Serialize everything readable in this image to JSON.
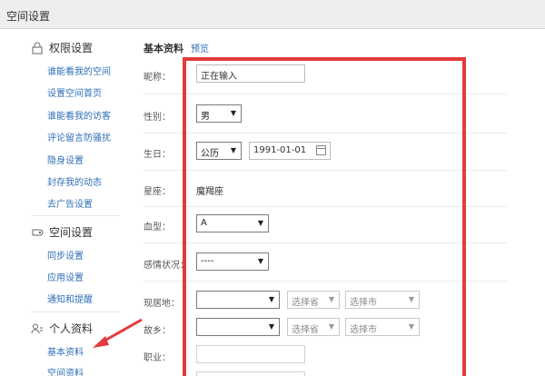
{
  "header": {
    "title": "空间设置"
  },
  "sidebar": {
    "sections": [
      {
        "title": "权限设置",
        "icon": "lock-icon",
        "items": [
          "谁能看我的空间",
          "设置空间首页",
          "谁能看我的访客",
          "评论留言防骚扰",
          "隐身设置",
          "封存我的动态",
          "去广告设置"
        ]
      },
      {
        "title": "空间设置",
        "icon": "space-settings-icon",
        "items": [
          "同步设置",
          "应用设置",
          "通知和提醒"
        ]
      },
      {
        "title": "个人资料",
        "icon": "user-profile-icon",
        "items": [
          "基本资料",
          "空间资料"
        ]
      }
    ]
  },
  "main": {
    "tabs": {
      "active": "基本资料",
      "preview": "预览"
    },
    "form": {
      "nickname_label": "昵称：",
      "nickname_value": "正在输入",
      "gender_label": "性别：",
      "gender_value": "男",
      "birthday_label": "生日：",
      "calendar_value": "公历",
      "birthday_value": "1991-01-01",
      "zodiac_label": "星座：",
      "zodiac_value": "魔羯座",
      "blood_label": "血型：",
      "blood_value": "A",
      "relationship_label": "感情状况：",
      "relationship_value": "----",
      "residence_label": "现居地：",
      "hometown_label": "故乡：",
      "province_placeholder": "选择省",
      "city_placeholder": "选择市",
      "job_label": "职业："
    }
  },
  "annotation": {
    "highlight_color": "#e23b3b"
  }
}
